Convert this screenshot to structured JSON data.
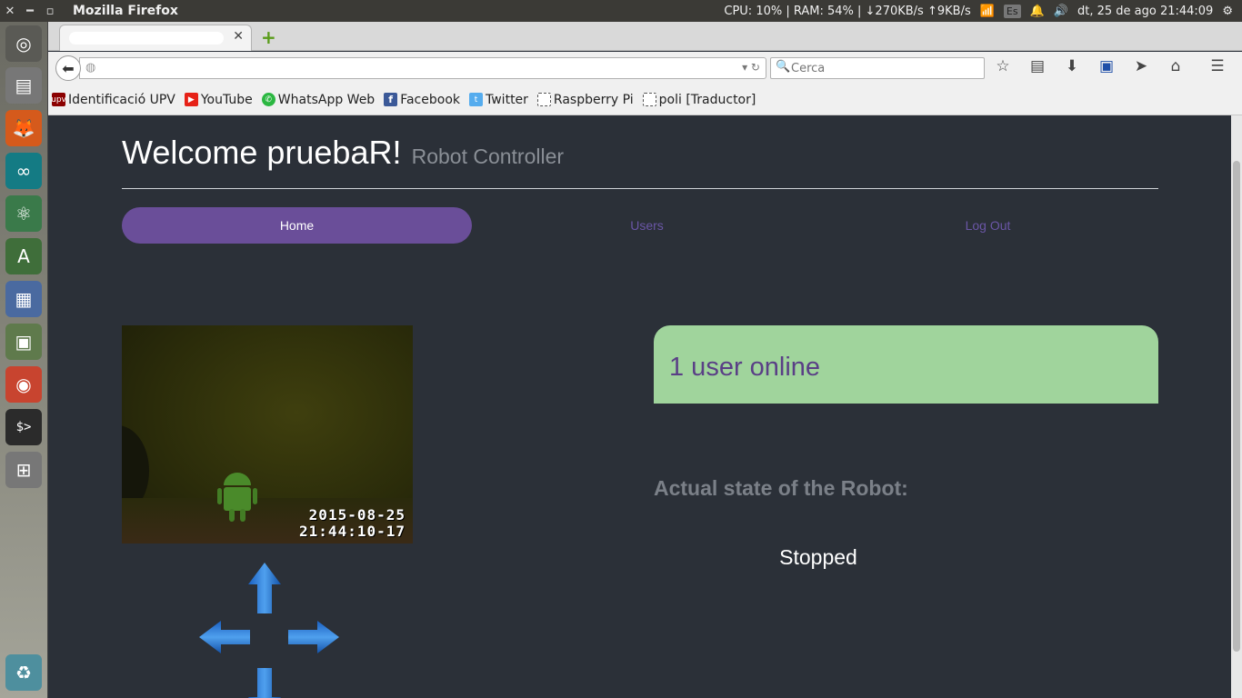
{
  "system_bar": {
    "window_title": "Mozilla Firefox",
    "stats": "CPU: 10% | RAM: 54% | ↓270KB/s ↑9KB/s",
    "keyboard": "Es",
    "datetime": "dt, 25 de ago 21:44:09"
  },
  "launcher": {
    "icons": [
      "ubuntu-dash-icon",
      "files-icon",
      "firefox-icon",
      "arduino-icon",
      "atom-icon",
      "android-studio-icon",
      "libreoffice-writer-icon",
      "app-icon",
      "chrome-icon",
      "terminal-icon",
      "workspace-switcher-icon",
      "trash-icon"
    ]
  },
  "browser": {
    "tab_title": "",
    "url": "",
    "search_placeholder": "Cerca",
    "bookmarks": [
      {
        "label": "Identificació UPV",
        "icon": "upv-icon",
        "color": "#8b0000"
      },
      {
        "label": "YouTube",
        "icon": "youtube-icon",
        "color": "#e62117"
      },
      {
        "label": "WhatsApp Web",
        "icon": "whatsapp-icon",
        "color": "#2bb741"
      },
      {
        "label": "Facebook",
        "icon": "facebook-icon",
        "color": "#3b5998"
      },
      {
        "label": "Twitter",
        "icon": "twitter-icon",
        "color": "#55acee"
      },
      {
        "label": "Raspberry Pi",
        "icon": "page-icon",
        "color": "#ffffff"
      },
      {
        "label": "poli [Traductor]",
        "icon": "page-icon",
        "color": "#ffffff"
      }
    ]
  },
  "page": {
    "welcome": "Welcome pruebaR!",
    "subtitle": "Robot Controller",
    "nav": [
      {
        "label": "Home",
        "active": true
      },
      {
        "label": "Users",
        "active": false
      },
      {
        "label": "Log Out",
        "active": false
      }
    ],
    "camera": {
      "date": "2015-08-25",
      "time": "21:44:10-17"
    },
    "online_status": "1 user online",
    "state_label": "Actual state of the Robot:",
    "state_value": "Stopped",
    "colors": {
      "accent": "#6a4e99",
      "online_bg": "#a0d49c",
      "page_bg": "#2b3038"
    }
  }
}
